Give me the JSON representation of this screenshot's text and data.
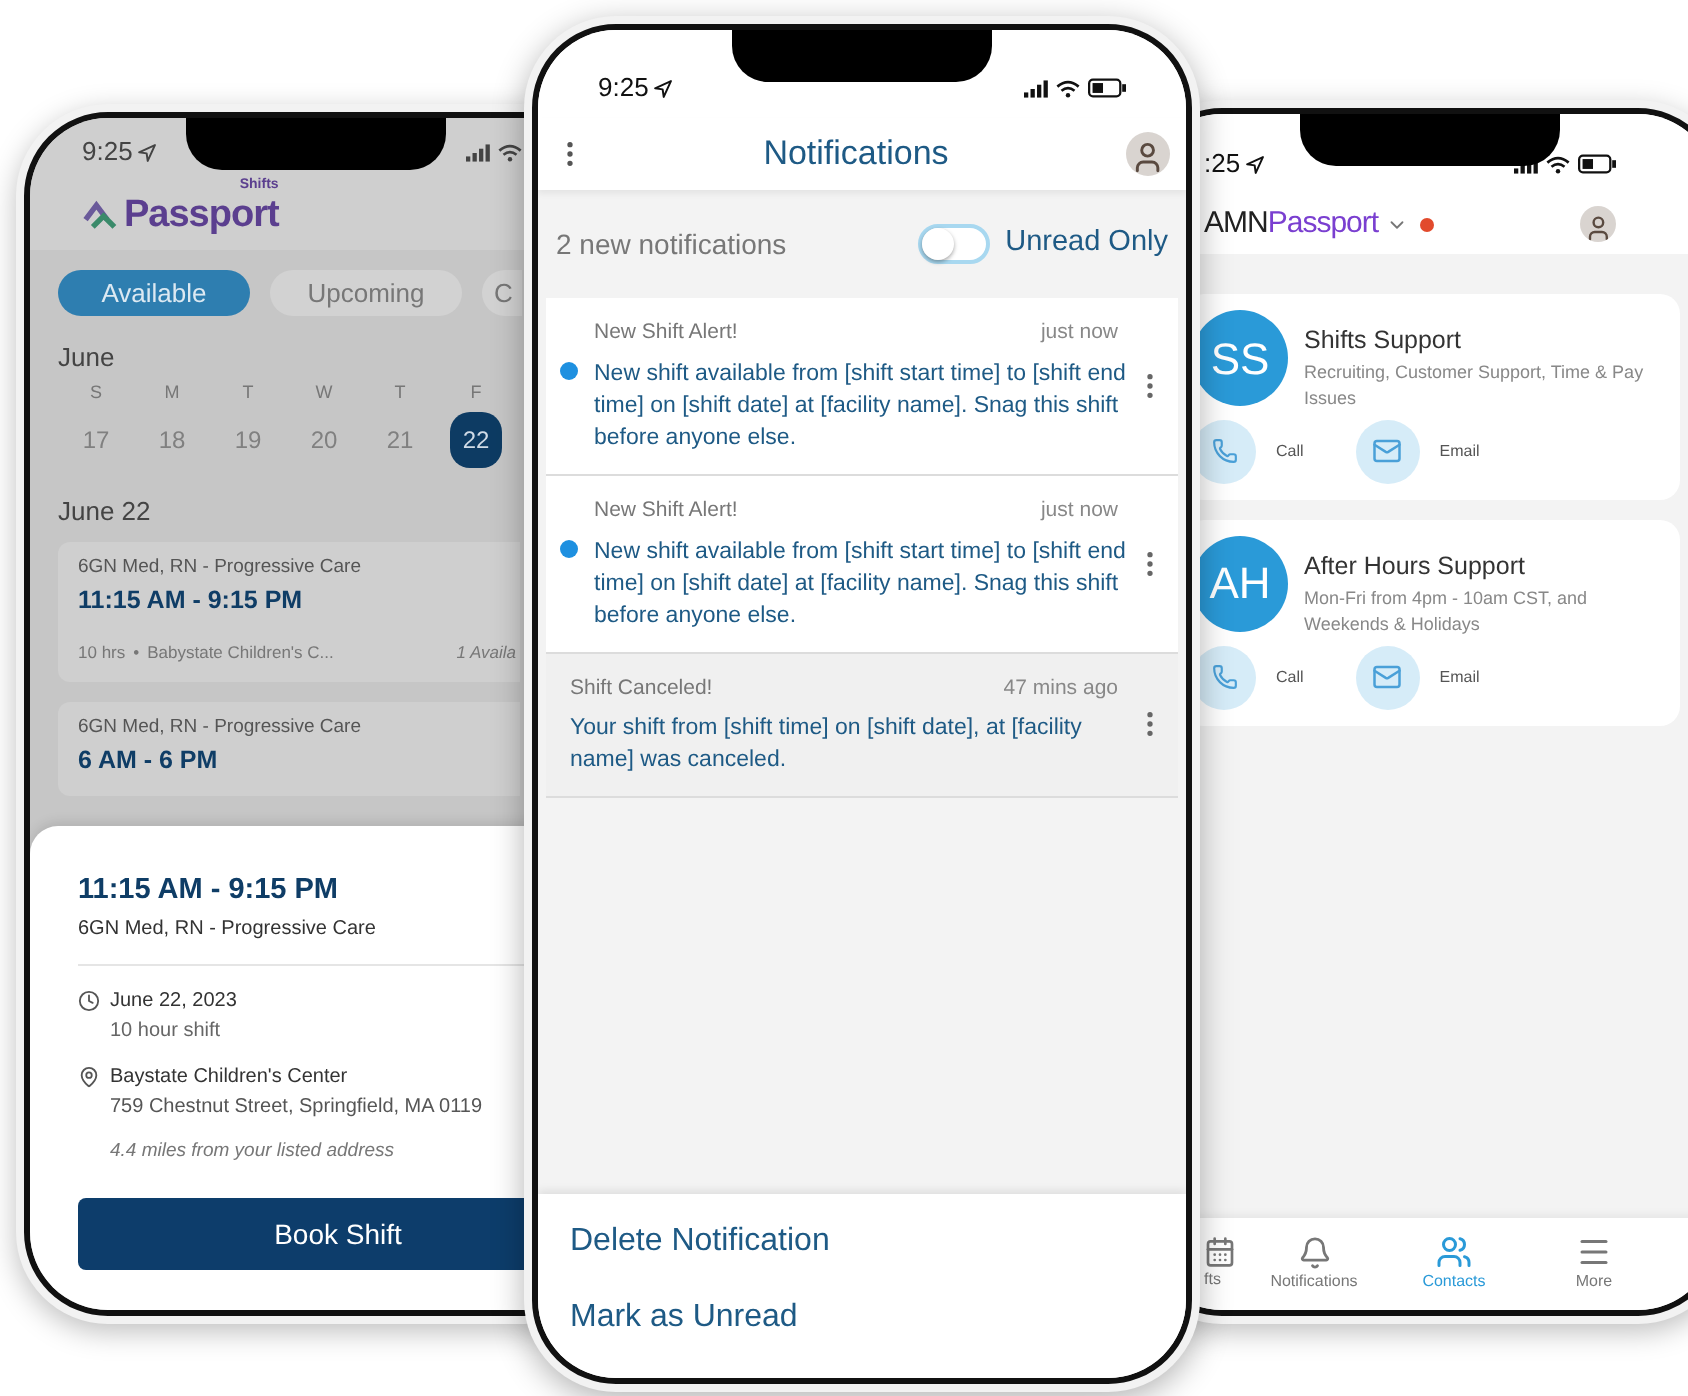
{
  "left_phone": {
    "status_time": "9:25",
    "logo_badge": "Shifts",
    "logo_text": "Passport",
    "tabs": [
      {
        "label": "Available",
        "selected": true
      },
      {
        "label": "Upcoming",
        "selected": false
      },
      {
        "label": "C",
        "selected": false
      }
    ],
    "month": "June",
    "weekdays": [
      "S",
      "M",
      "T",
      "W",
      "T",
      "F"
    ],
    "dates": [
      {
        "label": "17",
        "selected": false
      },
      {
        "label": "18",
        "selected": false
      },
      {
        "label": "19",
        "selected": false
      },
      {
        "label": "20",
        "selected": false
      },
      {
        "label": "21",
        "selected": false
      },
      {
        "label": "22",
        "selected": true
      }
    ],
    "day_heading": "June 22",
    "shift_cards": [
      {
        "unit": "6GN Med, RN - Progressive Care",
        "time": "11:15 AM - 9:15 PM",
        "hours": "10 hrs",
        "separator": "•",
        "facility": "Babystate Children's C...",
        "availability": "1 Availa"
      },
      {
        "unit": "6GN Med, RN - Progressive Care",
        "time": "6 AM - 6 PM"
      }
    ],
    "detail_sheet": {
      "time": "11:15 AM - 9:15 PM",
      "unit": "6GN Med, RN - Progressive Care",
      "date": "June 22, 2023",
      "duration": "10 hour shift",
      "facility": "Baystate Children's Center",
      "address": "759 Chestnut Street, Springfield, MA 0119",
      "distance": "4.4 miles from your listed address",
      "button": "Book Shift"
    }
  },
  "middle_phone": {
    "status_time": "9:25",
    "title": "Notifications",
    "summary": "2 new notifications",
    "unread_toggle": {
      "label": "Unread Only",
      "on": false
    },
    "notifications": [
      {
        "title": "New Shift Alert!",
        "time": "just now",
        "body": "New shift available from [shift start time] to [shift end time] on [shift date] at [facility name]. Snag this shift before anyone else.",
        "unread": true
      },
      {
        "title": "New Shift Alert!",
        "time": "just now",
        "body": "New shift available from [shift start time] to [shift end time] on [shift date] at [facility name]. Snag this shift before anyone else.",
        "unread": true
      },
      {
        "title": "Shift Canceled!",
        "time": "47 mins ago",
        "body": "Your shift from [shift time] on [shift date], at [facility name] was canceled.",
        "unread": false
      }
    ],
    "action_sheet": [
      "Delete Notification",
      "Mark as Unread"
    ]
  },
  "right_phone": {
    "status_time": ":25",
    "brand_prefix": "AMN",
    "brand_name": "Passport",
    "contacts": [
      {
        "initials": "SS",
        "name": "Shifts Support",
        "description": "Recruiting, Customer Support, Time & Pay Issues",
        "actions": [
          {
            "kind": "call",
            "label": "Call"
          },
          {
            "kind": "email",
            "label": "Email"
          }
        ]
      },
      {
        "initials": "AH",
        "name": "After Hours Support",
        "description": "Mon-Fri from 4pm - 10am CST, and Weekends & Holidays",
        "actions": [
          {
            "kind": "call",
            "label": "Call"
          },
          {
            "kind": "email",
            "label": "Email"
          }
        ]
      }
    ],
    "tab_bar": [
      {
        "kind": "shifts",
        "label": "fts",
        "selected": false
      },
      {
        "kind": "notifications",
        "label": "Notifications",
        "selected": false
      },
      {
        "kind": "contacts",
        "label": "Contacts",
        "selected": true
      },
      {
        "kind": "more",
        "label": "More",
        "selected": false
      }
    ]
  }
}
